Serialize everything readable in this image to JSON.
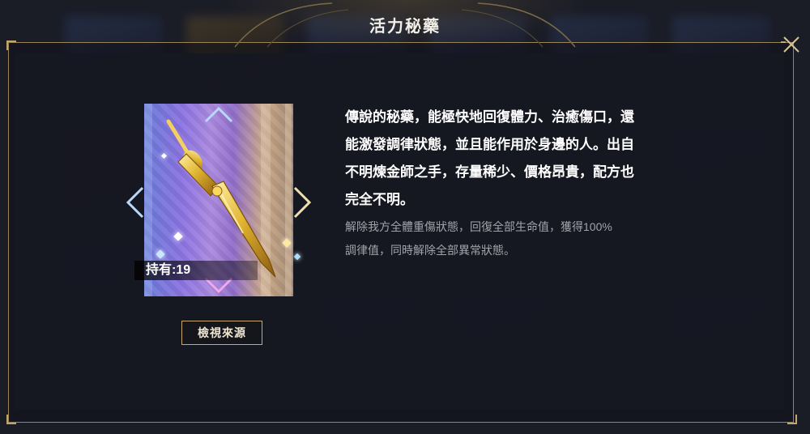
{
  "dialog": {
    "title": "活力秘藥",
    "close_icon": "close-icon"
  },
  "item": {
    "icon": "golden-sword-icon",
    "owned_text": "持有:19",
    "source_button_label": "檢視來源"
  },
  "description": {
    "lines": [
      "傳說的秘藥，能極快地回復體力、治癒傷口，還",
      "能激發調律狀態，並且能作用於身邊的人。出自",
      "不明煉金師之手，存量稀少、價格昂貴，配方也",
      "完全不明。"
    ]
  },
  "effect": {
    "lines": [
      "解除我方全體重傷狀態，回復全部生命值，獲得100%",
      "調律值，同時解除全部異常狀態。"
    ]
  },
  "colors": {
    "accent_gold": "#c9a868",
    "panel_border": "#9c8455",
    "text_primary": "#ffffff",
    "text_secondary": "#a3a3ab"
  }
}
